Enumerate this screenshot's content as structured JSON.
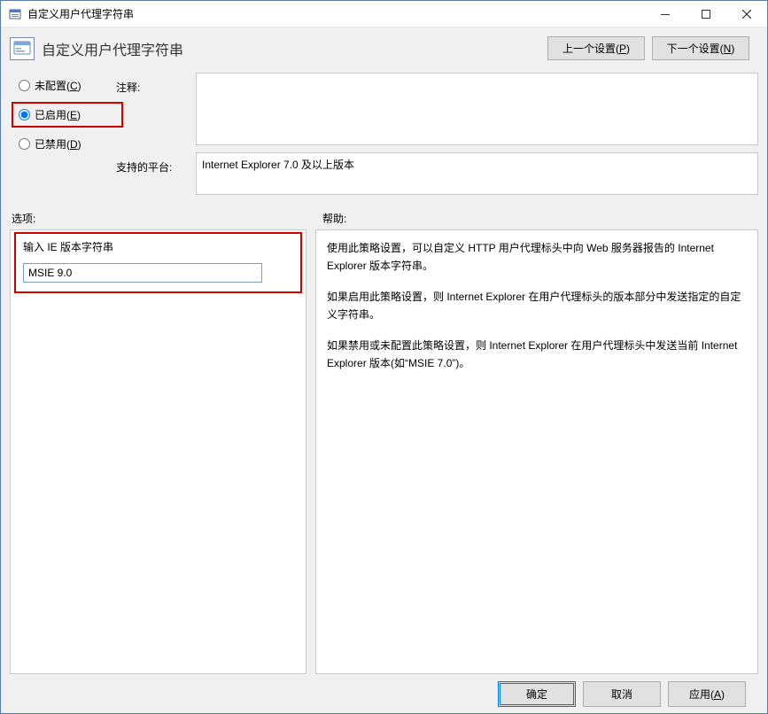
{
  "window": {
    "title": "自定义用户代理字符串"
  },
  "header": {
    "title": "自定义用户代理字符串",
    "prev": "上一个设置(P)",
    "next": "下一个设置(N)"
  },
  "radios": {
    "not_configured": "未配置(C)",
    "enabled": "已启用(E)",
    "disabled": "已禁用(D)",
    "selected": "enabled"
  },
  "labels": {
    "comment": "注释:",
    "platform": "支持的平台:",
    "options": "选项:",
    "help": "帮助:"
  },
  "comment_value": "",
  "platform_value": "Internet Explorer 7.0 及以上版本",
  "options": {
    "field_label": "输入 IE 版本字符串",
    "field_value": "MSIE 9.0"
  },
  "help": {
    "p1": "使用此策略设置，可以自定义 HTTP 用户代理标头中向 Web 服务器报告的 Internet Explorer 版本字符串。",
    "p2": "如果启用此策略设置，则 Internet Explorer 在用户代理标头的版本部分中发送指定的自定义字符串。",
    "p3": "如果禁用或未配置此策略设置，则 Internet Explorer 在用户代理标头中发送当前 Internet Explorer 版本(如“MSIE 7.0”)。"
  },
  "footer": {
    "ok": "确定",
    "cancel": "取消",
    "apply": "应用(A)"
  }
}
